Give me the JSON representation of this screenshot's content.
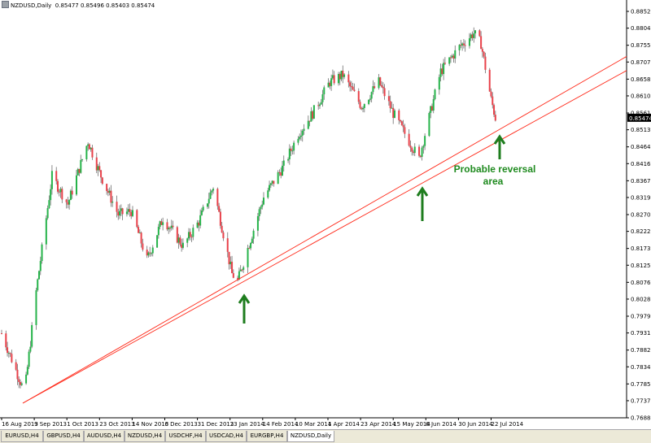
{
  "header": {
    "symbol_title": "NZDUSD,Daily",
    "quote_values": "0.85477 0.85496 0.85403 0.85474"
  },
  "price_axis": {
    "labels": [
      "0.88520",
      "0.88040",
      "0.87550",
      "0.87070",
      "0.86580",
      "0.86100",
      "0.85610",
      "0.85130",
      "0.84640",
      "0.84160",
      "0.83670",
      "0.83190",
      "0.82700",
      "0.82220",
      "0.81730",
      "0.81250",
      "0.80760",
      "0.80280",
      "0.79790",
      "0.79310",
      "0.78820",
      "0.78340",
      "0.77850",
      "0.77370",
      "0.76880"
    ],
    "current_price": "0.85474"
  },
  "time_axis": {
    "labels": [
      "16 Aug 2013",
      "9 Sep 2013",
      "1 Oct 2013",
      "23 Oct 2013",
      "14 Nov 2013",
      "6 Dec 2013",
      "31 Dec 2013",
      "23 Jan 2014",
      "14 Feb 2014",
      "10 Mar 2014",
      "1 Apr 2014",
      "23 Apr 2014",
      "15 May 2014",
      "6 Jun 2014",
      "30 Jun 2014",
      "22 Jul 2014"
    ]
  },
  "annotation": {
    "line1": "Probable reversal",
    "line2": "area"
  },
  "colors": {
    "bull": "#26b34a",
    "bear": "#e8414a",
    "wick": "#6e6e6e",
    "trendline": "#ff2a1a",
    "arrow": "#1e7d1e",
    "annotation_text": "#1e8a1e"
  },
  "tabs": [
    {
      "label": "EURUSD,H4",
      "active": false
    },
    {
      "label": "GBPUSD,H4",
      "active": false
    },
    {
      "label": "AUDUSD,H4",
      "active": false
    },
    {
      "label": "NZDUSD,H4",
      "active": false
    },
    {
      "label": "USDCHF,H4",
      "active": false
    },
    {
      "label": "USDCAD,H4",
      "active": false
    },
    {
      "label": "EURGBP,H4",
      "active": false
    },
    {
      "label": "NZDUSD,Daily",
      "active": true
    }
  ],
  "chart_data": {
    "type": "candlestick",
    "symbol": "NZDUSD",
    "timeframe": "Daily",
    "ylim": [
      0.7688,
      0.8866
    ],
    "trendlines": [
      {
        "from": [
          "16 Aug 2013",
          0.773
        ],
        "to": [
          "23 Jan 2014",
          0.8074
        ]
      },
      {
        "from": [
          "16 Aug 2013",
          0.773
        ],
        "to": [
          "23 Jan 2014",
          0.806
        ]
      }
    ],
    "closes_sampled": [
      {
        "date": "16 Aug 2013",
        "close": 0.793
      },
      {
        "date": "1 Sep 2013",
        "close": 0.776
      },
      {
        "date": "9 Sep 2013",
        "close": 0.805
      },
      {
        "date": "20 Sep 2013",
        "close": 0.838
      },
      {
        "date": "1 Oct 2013",
        "close": 0.83
      },
      {
        "date": "15 Oct 2013",
        "close": 0.848
      },
      {
        "date": "23 Oct 2013",
        "close": 0.839
      },
      {
        "date": "5 Nov 2013",
        "close": 0.827
      },
      {
        "date": "14 Nov 2013",
        "close": 0.828
      },
      {
        "date": "25 Nov 2013",
        "close": 0.814
      },
      {
        "date": "6 Dec 2013",
        "close": 0.826
      },
      {
        "date": "20 Dec 2013",
        "close": 0.818
      },
      {
        "date": "31 Dec 2013",
        "close": 0.825
      },
      {
        "date": "10 Jan 2014",
        "close": 0.835
      },
      {
        "date": "23 Jan 2014",
        "close": 0.81
      },
      {
        "date": "27 Jan 2014",
        "close": 0.808
      },
      {
        "date": "14 Feb 2014",
        "close": 0.832
      },
      {
        "date": "28 Feb 2014",
        "close": 0.841
      },
      {
        "date": "10 Mar 2014",
        "close": 0.85
      },
      {
        "date": "20 Mar 2014",
        "close": 0.856
      },
      {
        "date": "1 Apr 2014",
        "close": 0.865
      },
      {
        "date": "10 Apr 2014",
        "close": 0.867
      },
      {
        "date": "23 Apr 2014",
        "close": 0.858
      },
      {
        "date": "5 May 2014",
        "close": 0.865
      },
      {
        "date": "15 May 2014",
        "close": 0.856
      },
      {
        "date": "2 Jun 2014",
        "close": 0.843
      },
      {
        "date": "6 Jun 2014",
        "close": 0.85
      },
      {
        "date": "17 Jun 2014",
        "close": 0.868
      },
      {
        "date": "30 Jun 2014",
        "close": 0.875
      },
      {
        "date": "10 Jul 2014",
        "close": 0.879
      },
      {
        "date": "15 Jul 2014",
        "close": 0.876
      },
      {
        "date": "22 Jul 2014",
        "close": 0.86
      },
      {
        "date": "25 Jul 2014",
        "close": 0.8547
      }
    ]
  }
}
